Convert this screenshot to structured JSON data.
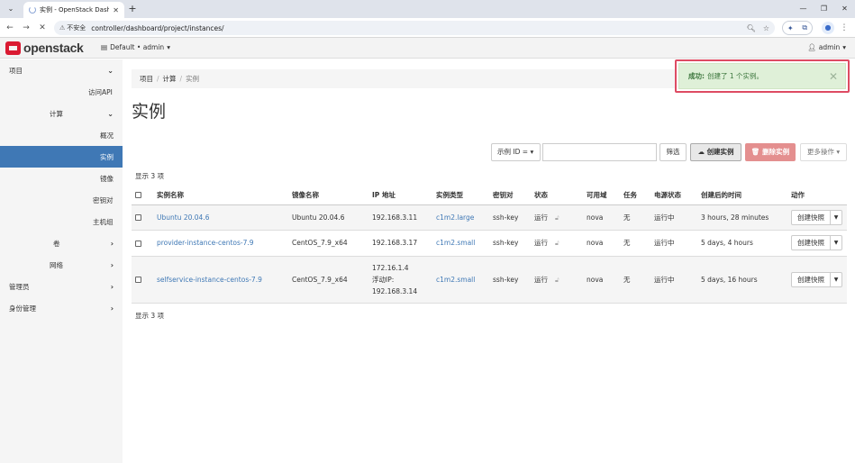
{
  "browser": {
    "tab_title": "实例 - OpenStack Dashboard",
    "insecure_label": "不安全",
    "url": "controller/dashboard/project/instances/"
  },
  "topnav": {
    "logo_text": "openstack",
    "project_selector": "Default • admin",
    "user": "admin"
  },
  "sidebar": {
    "items": [
      {
        "label": "项目",
        "chevron": "down"
      },
      {
        "label": "访问API"
      },
      {
        "label": "计算",
        "chevron": "down"
      },
      {
        "label": "概况"
      },
      {
        "label": "实例",
        "active": true
      },
      {
        "label": "镜像"
      },
      {
        "label": "密钥对"
      },
      {
        "label": "主机组"
      },
      {
        "label": "卷",
        "chevron": "right"
      },
      {
        "label": "网络",
        "chevron": "right"
      },
      {
        "label": "管理员",
        "chevron": "right"
      },
      {
        "label": "身份管理",
        "chevron": "right"
      }
    ]
  },
  "breadcrumb": [
    "项目",
    "计算",
    "实例"
  ],
  "page_title": "实例",
  "toolbar": {
    "filter_select": "示例 ID =",
    "filter_button": "筛选",
    "create_button": "创建实例",
    "delete_button": "删除实例",
    "more_button": "更多操作"
  },
  "count_text": "显示 3 项",
  "table": {
    "headers": [
      "实例名称",
      "镜像名称",
      "IP 地址",
      "实例类型",
      "密钥对",
      "状态",
      "可用域",
      "任务",
      "电源状态",
      "创建后的时间",
      "动作"
    ],
    "rows": [
      {
        "name": "Ubuntu 20.04.6",
        "image": "Ubuntu 20.04.6",
        "ip": [
          "192.168.3.11"
        ],
        "flavor": "c1m2.large",
        "keypair": "ssh-key",
        "status": "运行",
        "az": "nova",
        "task": "无",
        "power": "运行中",
        "age": "3 hours, 28 minutes",
        "action": "创建快照"
      },
      {
        "name": "provider-instance-centos-7.9",
        "image": "CentOS_7.9_x64",
        "ip": [
          "192.168.3.17"
        ],
        "flavor": "c1m2.small",
        "keypair": "ssh-key",
        "status": "运行",
        "az": "nova",
        "task": "无",
        "power": "运行中",
        "age": "5 days, 4 hours",
        "action": "创建快照"
      },
      {
        "name": "selfservice-instance-centos-7.9",
        "image": "CentOS_7.9_x64",
        "ip": [
          "172.16.1.4",
          "浮动IP:",
          "192.168.3.14"
        ],
        "flavor": "c1m2.small",
        "keypair": "ssh-key",
        "status": "运行",
        "az": "nova",
        "task": "无",
        "power": "运行中",
        "age": "5 days, 16 hours",
        "action": "创建快照"
      }
    ]
  },
  "toast": {
    "prefix": "成功:",
    "message": "创建了 1 个实例。",
    "color": "#dff0d8"
  },
  "colors": {
    "accent": "#3f78b5",
    "danger": "#e48f8f",
    "brand": "#da1a32"
  }
}
